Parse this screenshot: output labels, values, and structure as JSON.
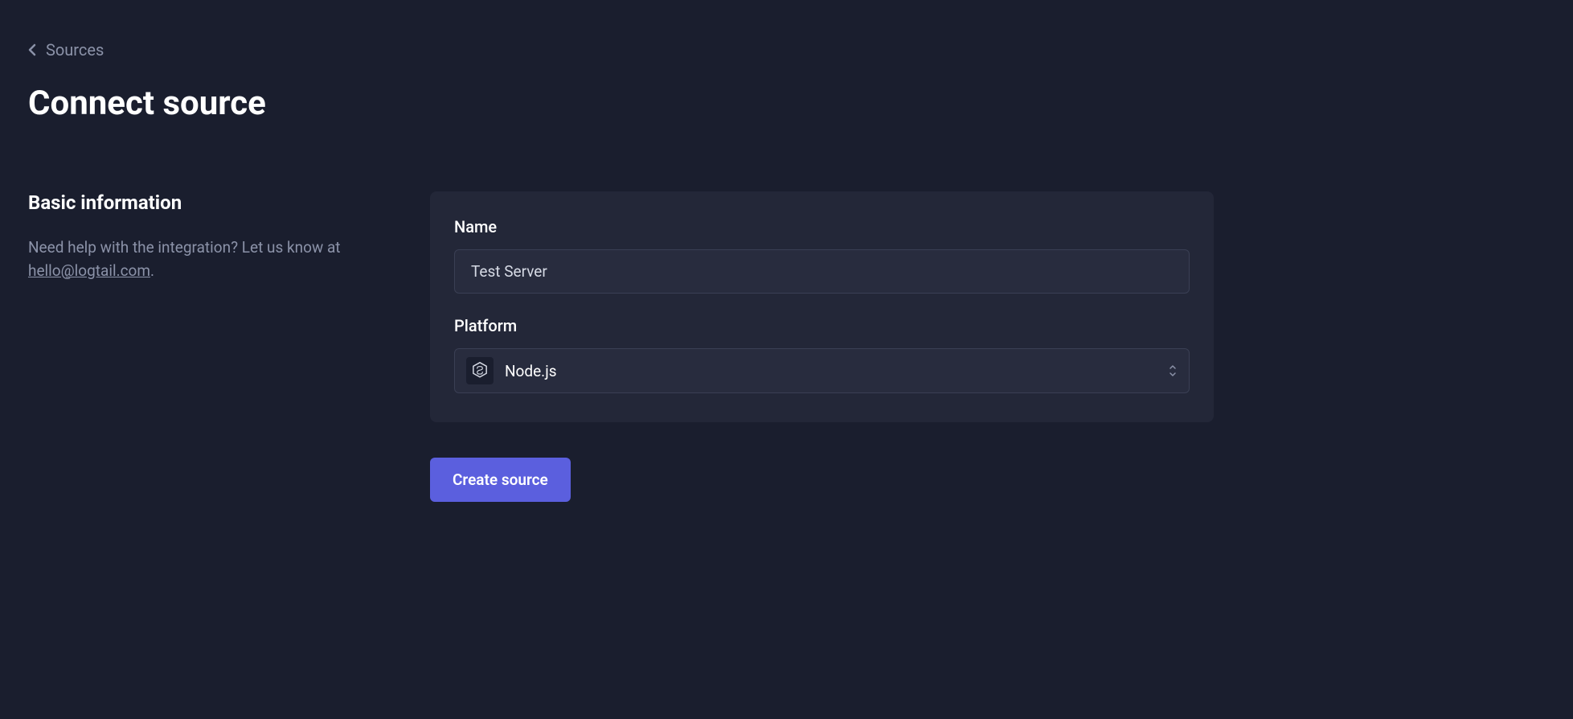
{
  "breadcrumb": {
    "label": "Sources"
  },
  "page": {
    "title": "Connect source"
  },
  "sidebar": {
    "section_title": "Basic information",
    "help_text_prefix": "Need help with the integration? Let us know at ",
    "help_email": "hello@logtail.com",
    "help_text_suffix": "."
  },
  "form": {
    "name_label": "Name",
    "name_value": "Test Server",
    "platform_label": "Platform",
    "platform_value": "Node.js",
    "platform_icon": "nodejs-icon"
  },
  "actions": {
    "create_label": "Create source"
  }
}
